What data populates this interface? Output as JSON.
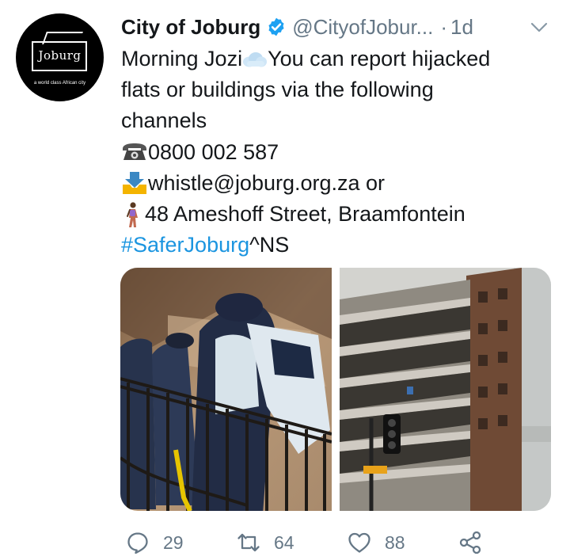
{
  "account": {
    "name": "City of Joburg",
    "handle": "@CityofJobur...",
    "separator": "·",
    "time": "1d",
    "avatar": {
      "logo_text": "Joburg",
      "tagline": "a world class African city"
    }
  },
  "tweet": {
    "lines": {
      "l1_prefix": "Morning Jozi",
      "l1_suffix": " You can report hijacked",
      "l2": "flats or buildings via the following",
      "l3": "channels",
      "l4": "0800 002 587",
      "l5": " whistle@joburg.org.za or",
      "l6": " 48 Ameshoff Street, Braamfontein",
      "l7_hashtag": "#SaferJoburg",
      "l7_suffix": " ^NS"
    },
    "emojis": [
      "cloud-emoji",
      "telephone-emoji",
      "inbox-tray-emoji",
      "woman-walking-emoji"
    ]
  },
  "actions": {
    "replies": "29",
    "retweets": "64",
    "likes": "88"
  },
  "colors": {
    "link": "#1b95e0",
    "muted": "#657786",
    "verified": "#1da1f2",
    "text": "#14171a"
  }
}
